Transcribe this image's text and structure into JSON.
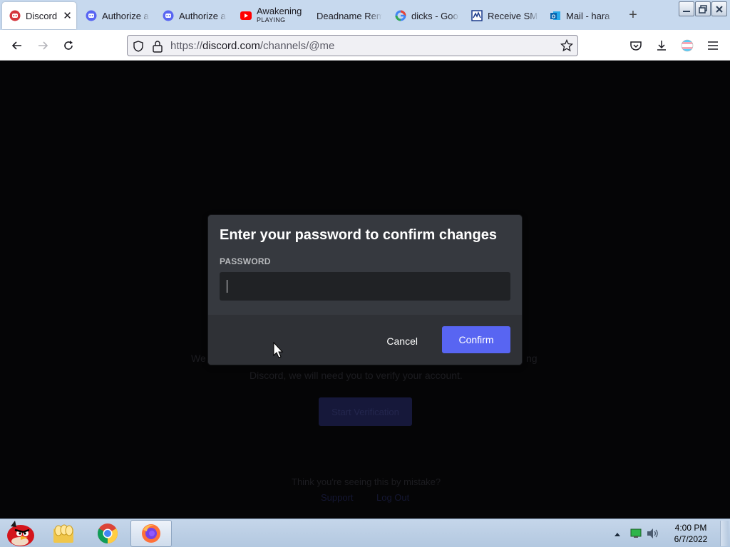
{
  "tabs": [
    {
      "title": "Discord",
      "icon": "discord-red-icon",
      "active": true
    },
    {
      "title": "Authorize a",
      "icon": "discord-icon"
    },
    {
      "title": "Authorize a",
      "icon": "discord-icon"
    },
    {
      "title": "Awakening",
      "subtitle": "PLAYING",
      "icon": "youtube-icon"
    },
    {
      "title": "Deadname Rem",
      "icon": ""
    },
    {
      "title": "dicks - Goo",
      "icon": "google-icon"
    },
    {
      "title": "Receive SM",
      "icon": "sms-icon"
    },
    {
      "title": "Mail - hara",
      "icon": "outlook-icon"
    }
  ],
  "url": {
    "host": "https://discord.com",
    "path": "/channels/@me"
  },
  "background": {
    "line1_left": "We",
    "line1_right": "ng",
    "line2": "Discord, we will need you to verify your account.",
    "verify_button": "Start Verification",
    "mistake": "Think you're seeing this by mistake?",
    "link1": "Support",
    "link2": "Log Out"
  },
  "modal": {
    "title": "Enter your password to confirm changes",
    "label": "PASSWORD",
    "password_value": "",
    "cancel": "Cancel",
    "confirm": "Confirm"
  },
  "colors": {
    "accent": "#5865f2",
    "modal_bg": "#36393f",
    "modal_footer": "#2f3136",
    "input_bg": "#202225"
  },
  "taskbar": {
    "time": "4:00 PM",
    "date": "6/7/2022"
  }
}
